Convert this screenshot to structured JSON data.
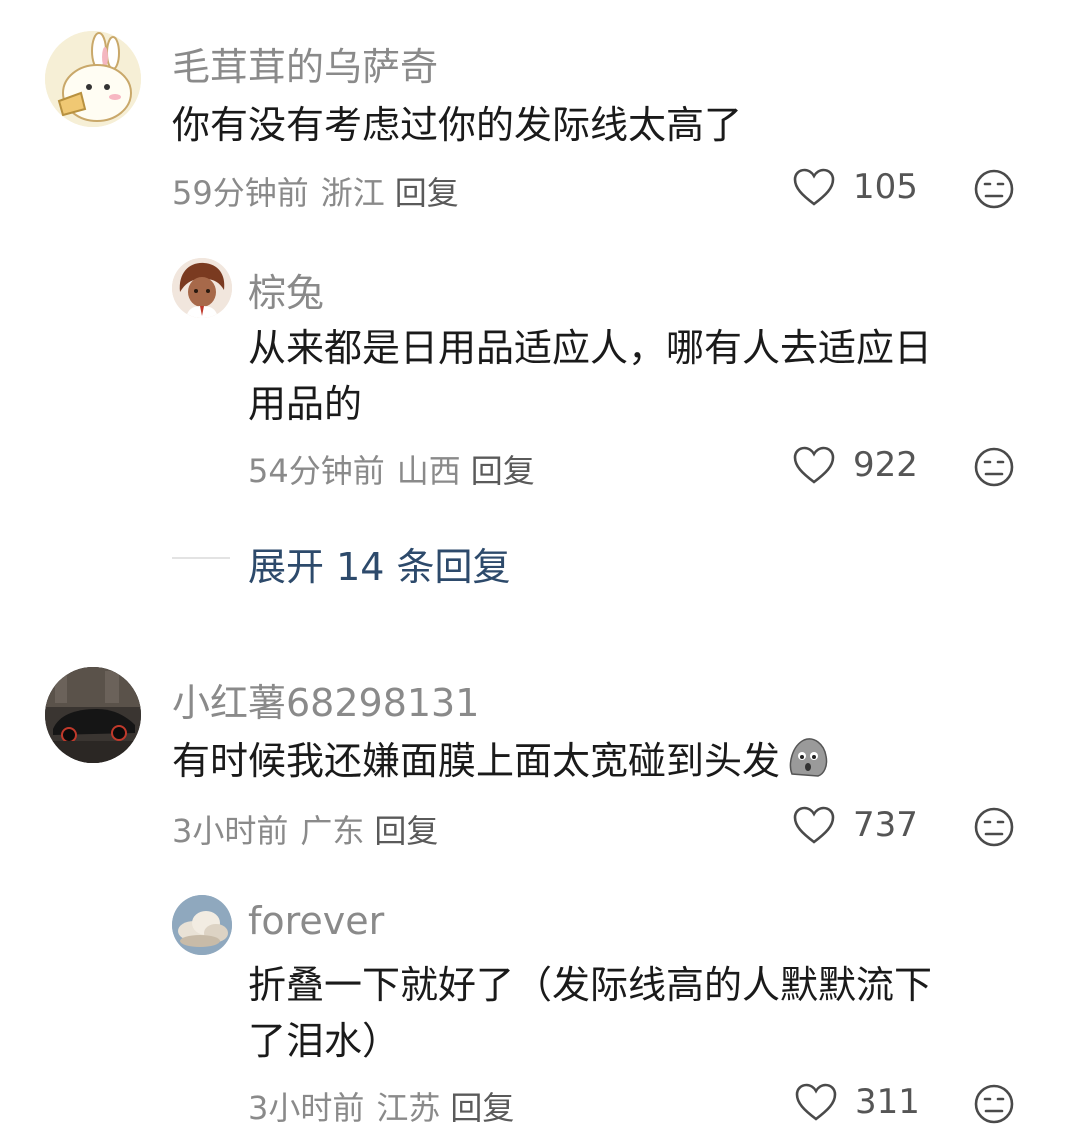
{
  "comments": [
    {
      "username": "毛茸茸的乌萨奇",
      "text": "你有没有考虑过你的发际线太高了",
      "time": "59分钟前",
      "location": "浙江",
      "reply_label": "回复",
      "likes": "105",
      "avatar_icon": "rabbit-cartoon-avatar",
      "replies": [
        {
          "username": "棕兔",
          "text_line1": "从来都是日用品适应人，哪有人去适应日",
          "text_line2": "用品的",
          "time": "54分钟前",
          "location": "山西",
          "reply_label": "回复",
          "likes": "922",
          "avatar_icon": "anime-character-avatar"
        }
      ],
      "expand_label": "展开 14 条回复"
    },
    {
      "username": "小红薯68298131",
      "text": "有时候我还嫌面膜上面太宽碰到头发",
      "time": "3小时前",
      "location": "广东",
      "reply_label": "回复",
      "likes": "737",
      "avatar_icon": "car-photo-avatar",
      "emoji_icon": "shocked-rock-emoji",
      "replies": [
        {
          "username": "forever",
          "text_line1": "折叠一下就好了（发际线高的人默默流下",
          "text_line2": "了泪水）",
          "time": "3小时前",
          "location": "江苏",
          "reply_label": "回复",
          "likes": "311",
          "avatar_icon": "cloud-sky-avatar"
        }
      ]
    }
  ],
  "colors": {
    "username": "#8a8a8a",
    "text": "#1a1a1a",
    "expand_link": "#2d4a6b",
    "divider": "#e3e3e3"
  }
}
